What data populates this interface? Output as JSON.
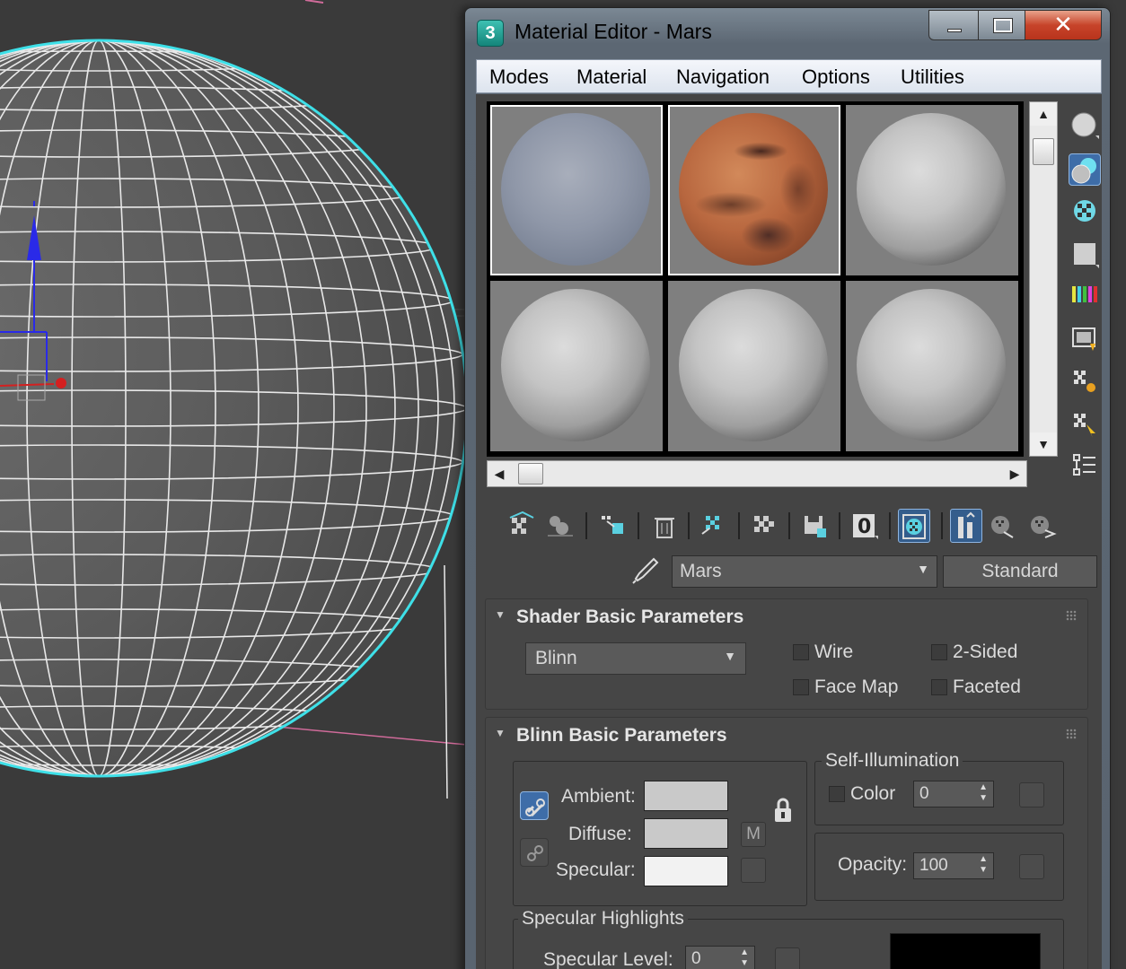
{
  "window": {
    "title": "Material Editor - Mars",
    "app_icon_label": "3",
    "close_glyph": "✕"
  },
  "menu": [
    "Modes",
    "Material",
    "Navigation",
    "Options",
    "Utilities"
  ],
  "slots": [
    {
      "material": "blue-gray sphere",
      "kind": "blue",
      "selected": true
    },
    {
      "material": "Mars",
      "kind": "mars",
      "active": true
    },
    {
      "material": "default",
      "kind": "gray"
    },
    {
      "material": "default",
      "kind": "gray"
    },
    {
      "material": "default",
      "kind": "gray"
    },
    {
      "material": "default",
      "kind": "gray"
    }
  ],
  "side_toolbar": [
    "sample-type-icon",
    "backlight-icon",
    "background-icon",
    "uv-tiling-icon",
    "video-color-check-icon",
    "make-preview-icon",
    "options-icon",
    "select-by-material-icon",
    "material-map-navigator-icon"
  ],
  "bottom_toolbar": [
    "get-material-icon",
    "put-to-scene-icon",
    "assign-to-selection-icon",
    "reset-map-icon",
    "make-unique-icon",
    "put-to-library-icon",
    "save-icon",
    "material-id-icon",
    "show-shaded-icon",
    "show-end-result-icon",
    "go-to-parent-icon",
    "go-forward-sibling-icon"
  ],
  "material_id_label": "0",
  "material_name": "Mars",
  "material_type": "Standard",
  "shader_rollout": {
    "title": "Shader Basic Parameters",
    "shader": "Blinn",
    "wire": "Wire",
    "two_sided": "2-Sided",
    "face_map": "Face Map",
    "faceted": "Faceted"
  },
  "blinn_rollout": {
    "title": "Blinn Basic Parameters",
    "ambient": "Ambient:",
    "diffuse": "Diffuse:",
    "specular": "Specular:",
    "m_button": "M",
    "self_illum_title": "Self-Illumination",
    "color_label": "Color",
    "color_value": "0",
    "opacity_label": "Opacity:",
    "opacity_value": "100",
    "spec_highlights_title": "Specular Highlights",
    "spec_level_label": "Specular Level:",
    "spec_level_value": "0",
    "colors": {
      "ambient": "#c9c9c9",
      "diffuse": "#c9c9c9",
      "specular": "#f2f2f2"
    }
  },
  "colors": {
    "accent": "#3e6da8",
    "viewport_bg": "#3a3a3a",
    "sphere_outline": "#3ee0e8"
  }
}
